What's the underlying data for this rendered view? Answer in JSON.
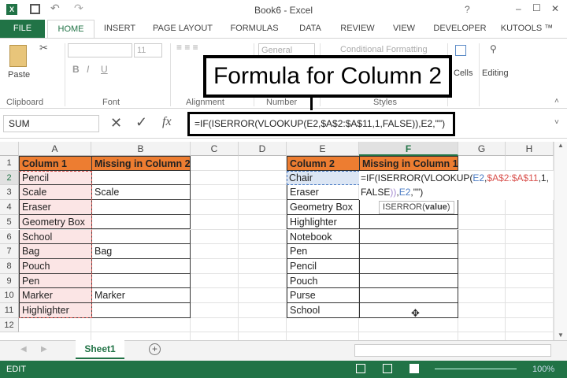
{
  "window": {
    "title": "Book6 - Excel",
    "help": "?",
    "min": "–",
    "max": "☐",
    "close": "✕"
  },
  "tabs": [
    "FILE",
    "HOME",
    "INSERT",
    "PAGE LAYOUT",
    "FORMULAS",
    "DATA",
    "REVIEW",
    "VIEW",
    "DEVELOPER",
    "KUTOOLS ™"
  ],
  "ribbon": {
    "paste": "Paste",
    "font_size": "11",
    "number_format": "General",
    "cond_format": "Conditional Formatting",
    "cells": "Cells",
    "editing": "Editing",
    "groups": [
      "Clipboard",
      "Font",
      "Alignment",
      "Number",
      "Styles"
    ]
  },
  "callout": "Formula for Column 2",
  "formula_bar": {
    "name_box": "SUM",
    "formula": "=IF(ISERROR(VLOOKUP(E2,$A$2:$A$11,1,FALSE)),E2,\"\")"
  },
  "columns": [
    "A",
    "B",
    "C",
    "D",
    "E",
    "F",
    "G",
    "H"
  ],
  "rows": [
    "1",
    "2",
    "3",
    "4",
    "5",
    "6",
    "7",
    "8",
    "9",
    "10",
    "11",
    "12"
  ],
  "table1": {
    "headers": [
      "Column 1",
      "Missing in Column 2"
    ],
    "col1": [
      "Pencil",
      "Scale",
      "Eraser",
      "Geometry Box",
      "School",
      "Bag",
      "Pouch",
      "Pen",
      "Marker",
      "Highlighter"
    ],
    "col2": [
      "",
      "Scale",
      "",
      "",
      "",
      "Bag",
      "",
      "",
      "Marker",
      ""
    ]
  },
  "table2": {
    "headers": [
      "Column 2",
      "Missing in Column 1"
    ],
    "col1": [
      "Chair",
      "Eraser",
      "Geometry Box",
      "Highlighter",
      "Notebook",
      "Pen",
      "Pencil",
      "Pouch",
      "Purse",
      "School"
    ]
  },
  "edit_formula": {
    "p1": "=IF(ISERROR(",
    "p2": "VLOOKUP(",
    "p3": "E2",
    ",": ",",
    "p4": "$A$2:$A$11",
    "p5": ",1,",
    "p6": "FALSE",
    "p7": "))",
    ",2": ",",
    "p8": "E2",
    "p9": ",\"\")"
  },
  "tooltip": {
    "fn": "ISERROR(",
    "arg": "value",
    ")": ")"
  },
  "sheet_tab": "Sheet1",
  "status": {
    "mode": "EDIT",
    "zoom": "100%"
  }
}
